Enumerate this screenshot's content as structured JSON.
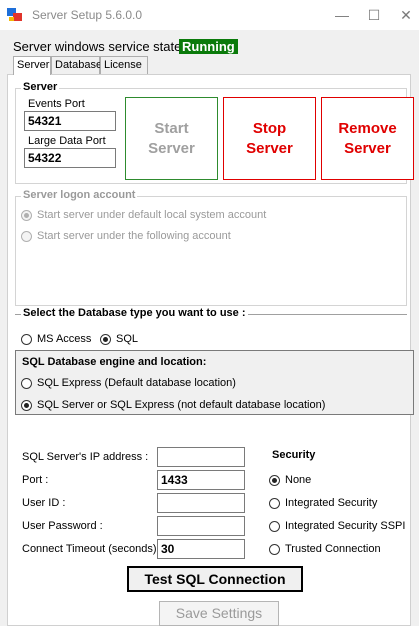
{
  "window": {
    "title": "Server Setup 5.6.0.0",
    "minimize": "—",
    "maximize": "☐",
    "close": "✕",
    "icon": "app-icon"
  },
  "service_state": {
    "label": "Server windows service state",
    "status": "Running"
  },
  "tabs": [
    {
      "label": "Server",
      "active": true
    },
    {
      "label": "Database",
      "active": false
    },
    {
      "label": "License",
      "active": false
    }
  ],
  "server_group": {
    "title": "Server",
    "events_port_label": "Events Port",
    "events_port_value": "54321",
    "large_data_port_label": "Large Data Port",
    "large_data_port_value": "54322",
    "start_button": "Start\nServer",
    "stop_button": "Stop\nServer",
    "remove_button": "Remove\nServer",
    "start_color": "#2e8b2e",
    "stop_color": "#e00000"
  },
  "logon_group": {
    "title": "Server logon account",
    "option_default": "Start server under default local system account",
    "option_following": "Start server under the following account"
  },
  "db_type": {
    "title": "Select the Database type you want to use :",
    "option_access": "MS Access",
    "option_sql": "SQL",
    "selected": "SQL"
  },
  "sql_engine": {
    "title": "SQL Database engine and location:",
    "option_express": "SQL Express (Default database location)",
    "option_server": "SQL Server or SQL Express (not default database location)",
    "selected": "server"
  },
  "connection": {
    "ip_label": "SQL Server's IP address :",
    "ip_value": "",
    "port_label": "Port :",
    "port_value": "1433",
    "userid_label": "User ID :",
    "userid_value": "",
    "password_label": "User Password :",
    "password_value": "",
    "timeout_label": "Connect Timeout (seconds) :",
    "timeout_value": "30"
  },
  "security": {
    "title": "Security",
    "options": [
      "None",
      "Integrated Security",
      "Integrated Security SSPI",
      "Trusted Connection"
    ],
    "selected": "None"
  },
  "buttons": {
    "test_sql": "Test SQL Connection",
    "save_settings": "Save Settings"
  }
}
